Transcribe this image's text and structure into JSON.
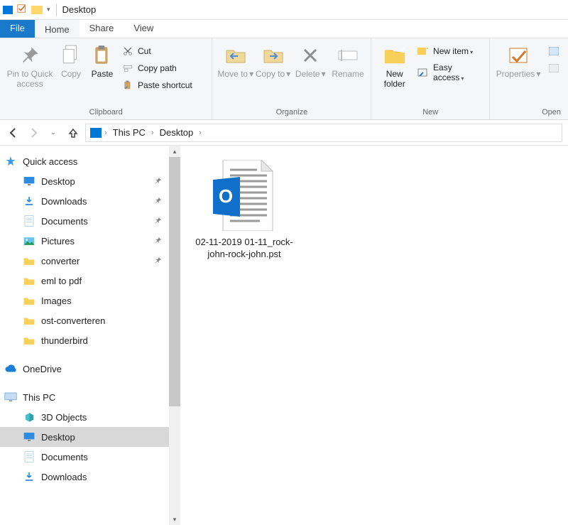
{
  "titlebar": {
    "title": "Desktop"
  },
  "tabs": {
    "file": "File",
    "home": "Home",
    "share": "Share",
    "view": "View"
  },
  "ribbon": {
    "clipboard": {
      "caption": "Clipboard",
      "pin": "Pin to Quick access",
      "copy": "Copy",
      "paste": "Paste",
      "cut": "Cut",
      "copy_path": "Copy path",
      "paste_shortcut": "Paste shortcut"
    },
    "organize": {
      "caption": "Organize",
      "move_to": "Move to",
      "copy_to": "Copy to",
      "delete": "Delete",
      "rename": "Rename"
    },
    "new": {
      "caption": "New",
      "new_folder": "New folder",
      "new_item": "New item",
      "easy_access": "Easy access"
    },
    "open": {
      "caption": "Open",
      "properties": "Properties"
    }
  },
  "breadcrumb": {
    "root": "This PC",
    "leaf": "Desktop"
  },
  "nav": {
    "quick_access": "Quick access",
    "qa_items": [
      {
        "label": "Desktop",
        "icon": "monitor",
        "pinned": true
      },
      {
        "label": "Downloads",
        "icon": "download",
        "pinned": true
      },
      {
        "label": "Documents",
        "icon": "doc",
        "pinned": true
      },
      {
        "label": "Pictures",
        "icon": "pictures",
        "pinned": true
      },
      {
        "label": "converter",
        "icon": "folder",
        "pinned": true
      },
      {
        "label": "eml to pdf",
        "icon": "folder",
        "pinned": false
      },
      {
        "label": "Images",
        "icon": "folder",
        "pinned": false
      },
      {
        "label": "ost-converteren",
        "icon": "folder",
        "pinned": false
      },
      {
        "label": "thunderbird",
        "icon": "folder",
        "pinned": false
      }
    ],
    "onedrive": "OneDrive",
    "this_pc": "This PC",
    "pc_items": [
      {
        "label": "3D Objects",
        "icon": "cube"
      },
      {
        "label": "Desktop",
        "icon": "monitor",
        "selected": true
      },
      {
        "label": "Documents",
        "icon": "doc"
      },
      {
        "label": "Downloads",
        "icon": "download"
      }
    ]
  },
  "files": [
    {
      "name": "02-11-2019 01-11_rock-john-rock-john.pst",
      "type": "outlook-pst"
    }
  ]
}
